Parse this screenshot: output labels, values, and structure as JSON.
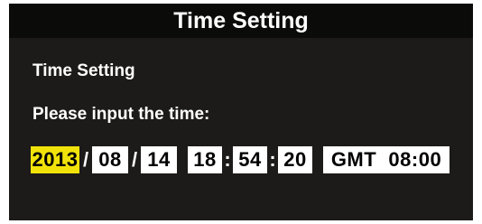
{
  "window": {
    "title": "Time Setting"
  },
  "content": {
    "section_title": "Time Setting",
    "prompt": "Please input the time:"
  },
  "time": {
    "year": "2013",
    "month": "08",
    "day": "14",
    "hour": "18",
    "minute": "54",
    "second": "20",
    "timezone": "GMT  08:00",
    "date_separator": "/",
    "time_separator": ":"
  },
  "colors": {
    "selected_field": "#f1e30a",
    "background": "#1c1b19",
    "title_bar": "#0b0b0a"
  }
}
